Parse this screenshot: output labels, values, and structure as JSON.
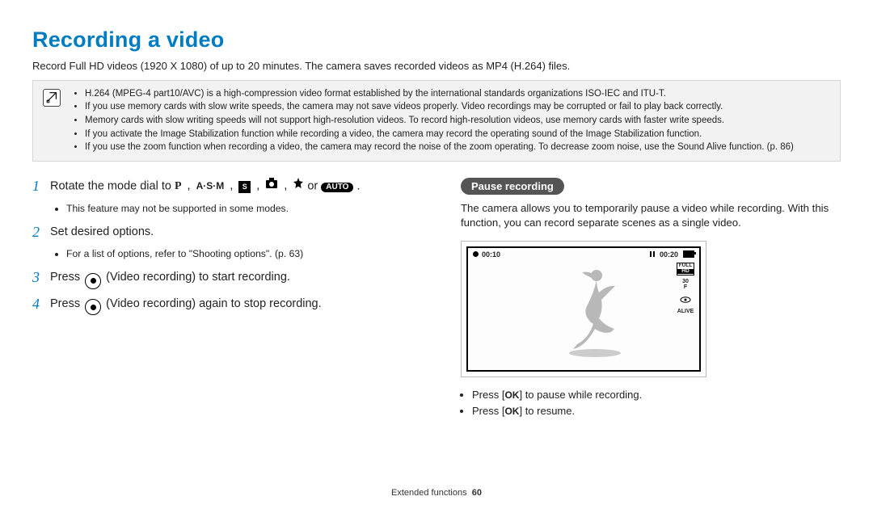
{
  "title": "Recording a video",
  "intro": "Record Full HD videos (1920 X 1080) of up to 20 minutes. The camera saves recorded videos as MP4 (H.264) files.",
  "note_bullets": [
    "H.264 (MPEG-4 part10/AVC) is a high-compression video format established by the international standards organizations ISO-IEC and ITU-T.",
    "If you use memory cards with slow write speeds, the camera may not save videos properly. Video recordings may be corrupted or fail to play back correctly.",
    "Memory cards with slow writing speeds will not support high-resolution videos. To record high-resolution videos, use memory cards with faster write speeds.",
    "If you activate the Image Stabilization function while recording a video, the camera may record the operating sound of the Image Stabilization function.",
    "If you use the zoom function when recording a video, the camera may record the noise of the zoom operating. To decrease zoom noise, use the Sound Alive function. (p. 86)"
  ],
  "steps": {
    "s1_prefix": "Rotate the mode dial to ",
    "s1_modes_p": "P",
    "s1_modes_asm": "A·S·M",
    "s1_modes_s": "S",
    "s1_or": " or ",
    "s1_auto": "AUTO",
    "s1_sub": "This feature may not be supported in some modes.",
    "s2": "Set desired options.",
    "s2_sub": "For a list of options, refer to \"Shooting options\". (p. 63)",
    "s3_pre": "Press ",
    "s3_post": " (Video recording) to start recording.",
    "s4_pre": "Press ",
    "s4_post": " (Video recording) again to stop recording."
  },
  "pause": {
    "label": "Pause recording",
    "description": "The camera allows you to temporarily pause a video while recording. With this function, you can record separate scenes as a single video.",
    "bullet1_pre": "Press [",
    "bullet1_post": "] to pause while recording.",
    "bullet2_pre": "Press [",
    "bullet2_post": "] to resume."
  },
  "screen": {
    "elapsed": "00:10",
    "remaining": "00:20",
    "full_hd_top": "FULL",
    "full_hd_bottom": "HD",
    "fps": "30",
    "fps_lbl": "F",
    "alive": "ALIVE"
  },
  "ok_label": "OK",
  "footer_section": "Extended functions",
  "footer_page": "60"
}
